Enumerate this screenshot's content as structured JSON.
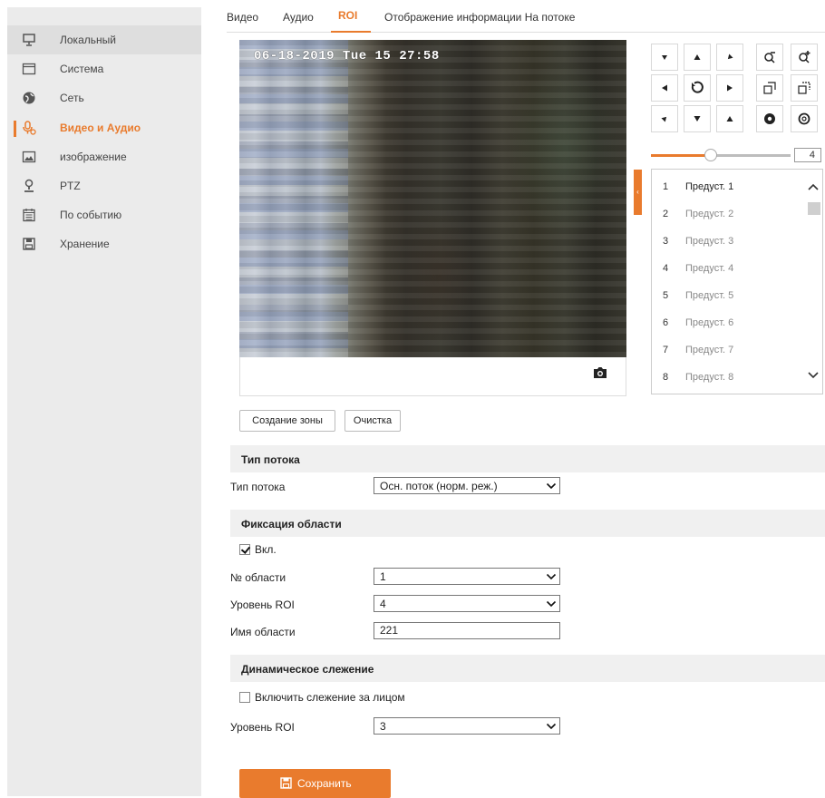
{
  "sidebar": {
    "items": [
      {
        "label": "Локальный",
        "icon": "monitor-icon"
      },
      {
        "label": "Система",
        "icon": "system-window-icon"
      },
      {
        "label": "Сеть",
        "icon": "network-globe-icon"
      },
      {
        "label": "Видео и Аудио",
        "icon": "microphone-video-icon"
      },
      {
        "label": "изображение",
        "icon": "image-icon"
      },
      {
        "label": "PTZ",
        "icon": "ptz-camera-icon"
      },
      {
        "label": "По событию",
        "icon": "event-calendar-icon"
      },
      {
        "label": "Хранение",
        "icon": "storage-disk-icon"
      }
    ],
    "active": "Видео и Аудио"
  },
  "tabs": [
    {
      "label": "Видео"
    },
    {
      "label": "Аудио"
    },
    {
      "label": "ROI"
    },
    {
      "label": "Отображение информации На потоке"
    }
  ],
  "active_tab": "ROI",
  "video": {
    "osd_text": "06-18-2019 Tue 15 27:58",
    "snapshot_icon": "camera-icon"
  },
  "ptz": {
    "speed_value": "4",
    "speed_level": 0.43,
    "buttons": [
      "pan-up-left",
      "pan-up",
      "pan-up-right",
      "zoom-out",
      "zoom-in",
      "pan-left",
      "auto-rotate",
      "pan-right",
      "focus-near",
      "focus-far",
      "pan-down-left",
      "pan-down",
      "pan-down-right",
      "iris-close",
      "iris-open"
    ]
  },
  "presets": [
    {
      "num": "1",
      "name": "Предуст. 1"
    },
    {
      "num": "2",
      "name": "Предуст. 2"
    },
    {
      "num": "3",
      "name": "Предуст. 3"
    },
    {
      "num": "4",
      "name": "Предуст. 4"
    },
    {
      "num": "5",
      "name": "Предуст. 5"
    },
    {
      "num": "6",
      "name": "Предуст. 6"
    },
    {
      "num": "7",
      "name": "Предуст. 7"
    },
    {
      "num": "8",
      "name": "Предуст. 8"
    }
  ],
  "actions": {
    "create_zone": "Создание зоны",
    "clear": "Очистка"
  },
  "stream_section": {
    "title": "Тип потока",
    "stream_type_label": "Тип потока",
    "stream_type_value": "Осн. поток (норм. реж.)"
  },
  "fixed_region": {
    "title": "Фиксация области",
    "enable_label": "Вкл.",
    "enabled": true,
    "region_no_label": "№ области",
    "region_no_value": "1",
    "roi_level_label": "Уровень ROI",
    "roi_level_value": "4",
    "region_name_label": "Имя области",
    "region_name_value": "221"
  },
  "dynamic_tracking": {
    "title": "Динамическое слежение",
    "face_tracking_label": "Включить слежение за лицом",
    "face_tracking_enabled": false,
    "roi_level_label": "Уровень ROI",
    "roi_level_value": "3"
  },
  "save_label": "Сохранить",
  "colors": {
    "accent": "#e97b2d",
    "sidebar_bg": "#ebebeb",
    "section_bg": "#f0f0f0"
  }
}
